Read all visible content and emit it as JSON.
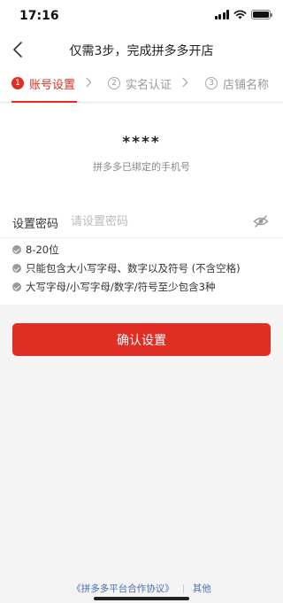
{
  "status_bar": {
    "time": "17:16",
    "icons": [
      "signal-icon",
      "wifi-icon",
      "battery-icon"
    ]
  },
  "nav": {
    "title": "仅需3步，完成拼多多开店",
    "back_icon": "chevron-left-icon"
  },
  "steps": [
    {
      "num": "1",
      "label": "账号设置",
      "active": true
    },
    {
      "num": "2",
      "label": "实名认证",
      "active": false
    },
    {
      "num": "3",
      "label": "店铺名称",
      "active": false
    }
  ],
  "account": {
    "phone_mask": "****",
    "phone_hint": "拼多多已绑定的手机号"
  },
  "password": {
    "label": "设置密码",
    "value": "",
    "placeholder": "请设置密码",
    "toggle_icon": "eye-off-icon"
  },
  "rules": [
    "8-20位",
    "只能包含大小写字母、数字以及符号 (不含空格)",
    "大写字母/小写字母/数字/符号至少包含3种"
  ],
  "confirm_label": "确认设置",
  "footer": {
    "agreement": "《拼多多平台合作协议》",
    "other": "其他"
  },
  "colors": {
    "accent": "#e02e24",
    "link": "#4a6fae",
    "background": "#f4f4f4"
  }
}
